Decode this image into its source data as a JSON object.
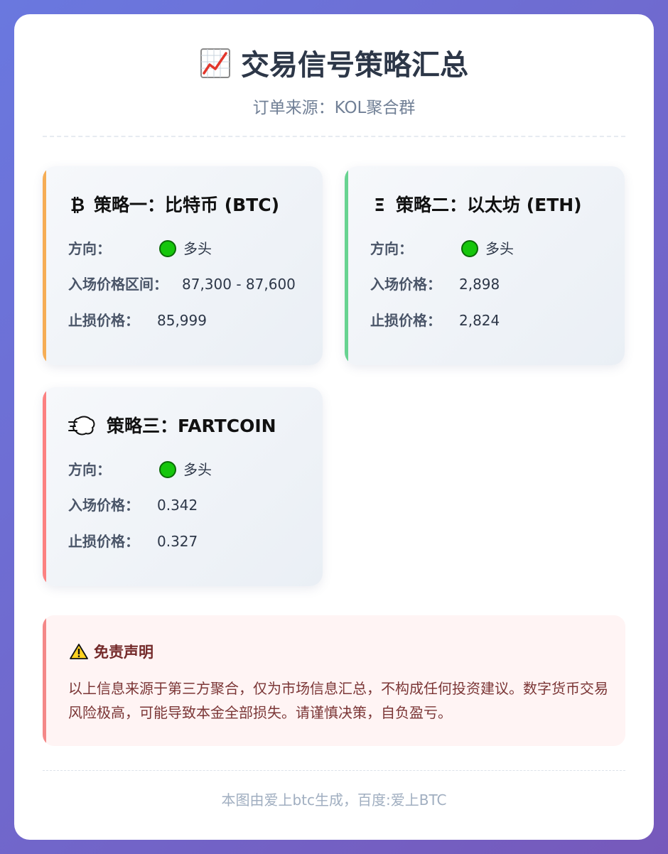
{
  "header": {
    "title": "交易信号策略汇总",
    "subtitle": "订单来源：KOL聚合群",
    "icon": "chart-increasing-icon"
  },
  "strategies": [
    {
      "symbol": "₿",
      "icon": "bitcoin-icon",
      "title": "策略一：比特币 (BTC)",
      "accent": "#f6ad55",
      "rows": [
        {
          "label": "方向：",
          "value": "多头",
          "indicator": "green-circle"
        },
        {
          "label": "入场价格区间：",
          "value": "87,300 - 87,600"
        },
        {
          "label": "止损价格：",
          "value": "85,999"
        }
      ]
    },
    {
      "symbol": "Ξ",
      "icon": "ethereum-icon",
      "title": "策略二：以太坊 (ETH)",
      "accent": "#68d391",
      "rows": [
        {
          "label": "方向：",
          "value": "多头",
          "indicator": "green-circle"
        },
        {
          "label": "入场价格：",
          "value": "2,898"
        },
        {
          "label": "止损价格：",
          "value": "2,824"
        }
      ]
    },
    {
      "symbol": "",
      "icon": "dashing-away-icon",
      "title": "策略三：FARTCOIN",
      "accent": "#fc8181",
      "rows": [
        {
          "label": "方向：",
          "value": "多头",
          "indicator": "green-circle"
        },
        {
          "label": "入场价格：",
          "value": "0.342"
        },
        {
          "label": "止损价格：",
          "value": "0.327"
        }
      ]
    }
  ],
  "disclaimer": {
    "icon": "warning-icon",
    "title": "免责声明",
    "text": "以上信息来源于第三方聚合，仅为市场信息汇总，不构成任何投资建议。数字货币交易风险极高，可能导致本金全部损失。请谨慎决策，自负盈亏。"
  },
  "footer": {
    "text": "本图由爱上btc生成，百度:爱上BTC"
  },
  "colors": {
    "direction_long": "#16c60c",
    "background_start": "#6a78df",
    "background_end": "#7659bb"
  }
}
